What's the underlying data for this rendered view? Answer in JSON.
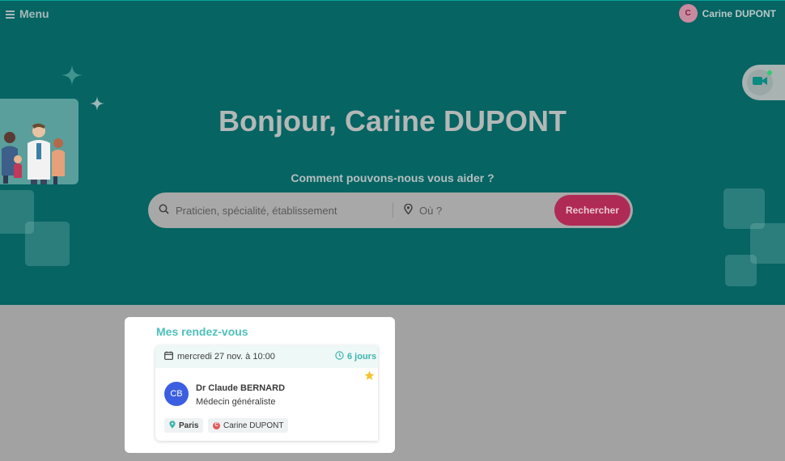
{
  "header": {
    "menu_label": "Menu",
    "user_initial": "C",
    "user_name": "Carine DUPONT"
  },
  "hero": {
    "greeting": "Bonjour, Carine DUPONT",
    "help_text": "Comment pouvons-nous vous aider ?"
  },
  "search": {
    "what_placeholder": "Praticien, spécialité, établissement",
    "where_placeholder": "Où ?",
    "button_label": "Rechercher"
  },
  "appointments": {
    "title": "Mes rendez-vous",
    "items": [
      {
        "date": "mercredi 27 nov. à 10:00",
        "until": "6 jours",
        "doctor_initials": "CB",
        "doctor_name": "Dr Claude BERNARD",
        "specialty": "Médecin généraliste",
        "place": "Paris",
        "patient": "Carine DUPONT"
      }
    ]
  },
  "colors": {
    "hero_bg": "#066463",
    "accent": "#b02a56",
    "teal_text": "#4ec0bb",
    "doctor_avatar": "#3b5fe0"
  }
}
